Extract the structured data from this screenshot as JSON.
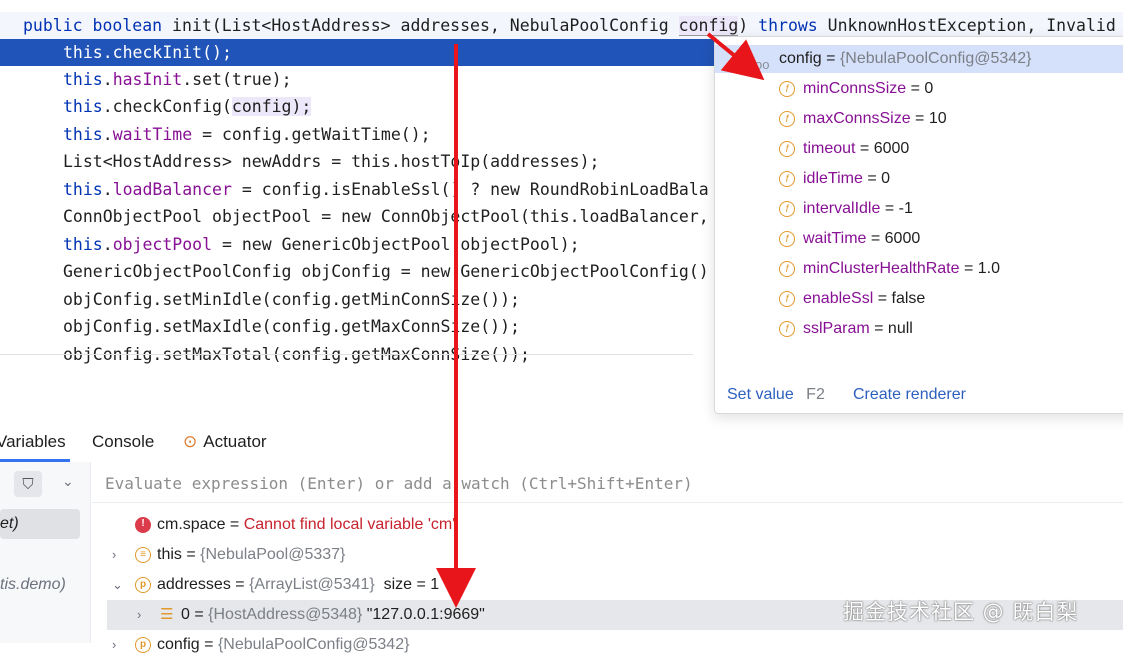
{
  "editor": {
    "signature": {
      "kw1": "public",
      "kw2": "boolean",
      "rest1": " init(List<HostAddress> addresses, NebulaPoolConfig ",
      "param": "config",
      "rest2": ") ",
      "kw3": "throws",
      "rest3": " UnknownHostException, Invalid"
    },
    "lines": [
      {
        "pre": "this",
        "mid": ".checkInit();",
        "field": "",
        "post": ""
      },
      {
        "pre": "this",
        "mid": ".",
        "field": "hasInit",
        "post": ".set(true);"
      },
      {
        "pre": "this",
        "mid": ".checkConfig(",
        "field": "",
        "post": "config);"
      },
      {
        "pre": "this",
        "mid": ".",
        "field": "waitTime",
        "post": " = config.getWaitTime();"
      },
      {
        "pre": "",
        "mid": "List<HostAddress> newAddrs = ",
        "field": "",
        "post": "this.hostToIp(addresses);"
      },
      {
        "pre": "this",
        "mid": ".",
        "field": "loadBalancer",
        "post": " = config.isEnableSsl() ? new RoundRobinLoadBala"
      },
      {
        "pre": "",
        "mid": "ConnObjectPool objectPool = ",
        "field": "",
        "post": "new ConnObjectPool(this.loadBalancer,"
      },
      {
        "pre": "this",
        "mid": ".",
        "field": "objectPool",
        "post": " = new GenericObjectPool(objectPool);"
      },
      {
        "pre": "",
        "mid": "GenericObjectPoolConfig objConfig = ",
        "field": "",
        "post": "new GenericObjectPoolConfig()"
      },
      {
        "pre": "",
        "mid": "objConfig.setMinIdle(",
        "field": "",
        "post": "config.getMinConnSize());"
      },
      {
        "pre": "",
        "mid": "objConfig.setMaxIdle(",
        "field": "",
        "post": "config.getMaxConnSize());"
      },
      {
        "pre": "",
        "mid": "objConfig.setMaxTotal(",
        "field": "",
        "post": "config.getMaxConnSize());"
      }
    ]
  },
  "popup": {
    "root": {
      "name": "config",
      "value": "{NebulaPoolConfig@5342}"
    },
    "fields": [
      {
        "name": "minConnsSize",
        "value": "0"
      },
      {
        "name": "maxConnsSize",
        "value": "10"
      },
      {
        "name": "timeout",
        "value": "6000"
      },
      {
        "name": "idleTime",
        "value": "0"
      },
      {
        "name": "intervalIdle",
        "value": "-1"
      },
      {
        "name": "waitTime",
        "value": "6000"
      },
      {
        "name": "minClusterHealthRate",
        "value": "1.0"
      },
      {
        "name": "enableSsl",
        "value": "false"
      },
      {
        "name": "sslParam",
        "value": "null"
      }
    ],
    "field_icon": "f",
    "set_value": "Set value",
    "set_value_shortcut": "F2",
    "create_renderer": "Create renderer"
  },
  "panel": {
    "tabs": {
      "variables": "Variables",
      "console": "Console",
      "actuator": "Actuator"
    },
    "eval_placeholder": "Evaluate expression (Enter) or add a watch (Ctrl+Shift+Enter)",
    "frames": [
      "et)",
      "tis.demo)"
    ],
    "vars": {
      "error": {
        "name": "cm.space",
        "eq": " = ",
        "value": "Cannot find local variable 'cm'"
      },
      "this": {
        "name": "this",
        "eq": " = ",
        "value": "{NebulaPool@5337}"
      },
      "addresses": {
        "name": "addresses",
        "eq": " = ",
        "value": "{ArrayList@5341}",
        "size_label": "size = 1"
      },
      "item0": {
        "name": "0",
        "eq": " = ",
        "value": "{HostAddress@5348}",
        "str": "\"127.0.0.1:9669\""
      },
      "config": {
        "name": "config",
        "eq": " = ",
        "value": "{NebulaPoolConfig@5342}"
      }
    }
  },
  "watermark": "掘金技术社区 @ 既白梨",
  "colors": {
    "highlight": "#2154b8",
    "keyword": "#0033b3",
    "field": "#871094",
    "arrow": "#e8161a",
    "link": "#2d5fbf"
  }
}
